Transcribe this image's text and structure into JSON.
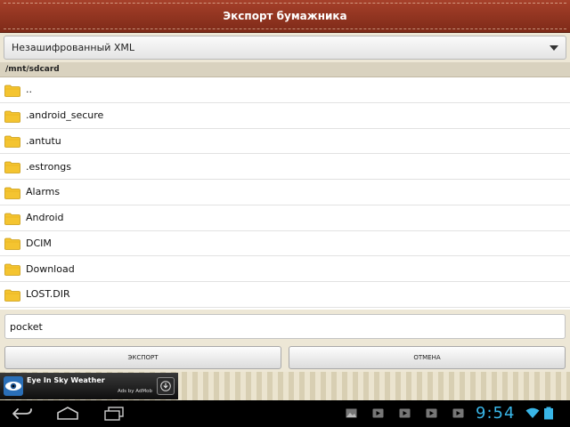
{
  "header": {
    "title": "Экспорт бумажника"
  },
  "format_select": {
    "value": "Незашифрованный XML"
  },
  "path": "/mnt/sdcard",
  "files": [
    {
      "name": ".."
    },
    {
      "name": ".android_secure"
    },
    {
      "name": ".antutu"
    },
    {
      "name": ".estrongs"
    },
    {
      "name": "Alarms"
    },
    {
      "name": "Android"
    },
    {
      "name": "DCIM"
    },
    {
      "name": "Download"
    },
    {
      "name": "LOST.DIR"
    }
  ],
  "filename_input": {
    "value": "pocket"
  },
  "buttons": {
    "export": "ЭКСПОРТ",
    "cancel": "ОТМЕНА"
  },
  "ad": {
    "title": "Eye In Sky Weather",
    "sub": "Ads by AdMob"
  },
  "status": {
    "time": "9:54"
  },
  "icons": {
    "folder": "folder-icon",
    "dropdown": "chevron-down-icon",
    "back": "back-icon",
    "home": "home-icon",
    "recents": "recent-apps-icon",
    "download": "download-icon",
    "wifi": "wifi-icon",
    "battery": "battery-icon"
  },
  "colors": {
    "title_bar": "#8e3520",
    "clock": "#39b6e8",
    "folder": "#f4c430"
  }
}
